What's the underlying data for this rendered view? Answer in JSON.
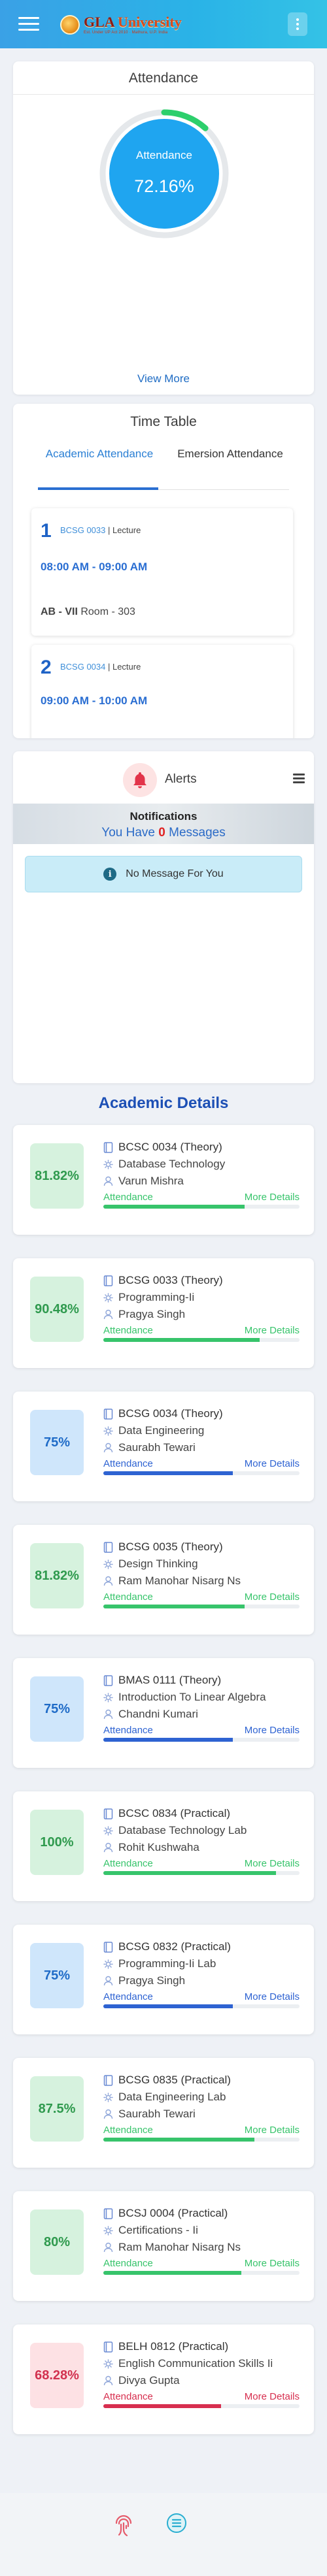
{
  "header": {
    "menu_icon": "hamburger-icon",
    "logo_name_g": "GLA",
    "logo_name_rest": " University",
    "logo_subtitle": "Est. Under UP Act 2010 · Mathura, U.P. India",
    "more_icon": "kebab-vertical-icon"
  },
  "attendance": {
    "title": "Attendance",
    "label": "Attendance",
    "percent": "72.16%",
    "percent_value": 72.16,
    "view_more": "View More",
    "colors": {
      "fill": "#1fa5f0",
      "progress": "#2dcf6c",
      "track": "#e5e8eb"
    }
  },
  "timetable": {
    "title": "Time Table",
    "tabs": [
      {
        "label": "Academic Attendance",
        "active": true
      },
      {
        "label": "Emersion Attendance",
        "active": false
      }
    ],
    "lectures": [
      {
        "num": "1",
        "code": "BCSG 0033",
        "type": " | Lecture",
        "time": "08:00 AM - 09:00 AM",
        "block": "AB - VII",
        "room": " Room - 303"
      },
      {
        "num": "2",
        "code": "BCSG 0034",
        "type": " | Lecture",
        "time": "09:00 AM - 10:00 AM",
        "block": "",
        "room": ""
      }
    ]
  },
  "alerts": {
    "title": "Alerts",
    "bell_icon": "bell-icon",
    "menu_icon": "list-menu-icon",
    "notifications_heading": "Notifications",
    "messages_prefix": "You Have ",
    "messages_count": "0",
    "messages_suffix": " Messages",
    "no_message": "No Message For You",
    "info_icon": "info-icon"
  },
  "academic": {
    "title": "Academic Details",
    "attendance_label": "Attendance",
    "more_details": "More Details",
    "colors": {
      "green": {
        "bg": "#d6f2de",
        "text": "#2f9a4e",
        "bar": "#37c46b"
      },
      "blue": {
        "bg": "#cfe6fb",
        "text": "#1f6bc7",
        "bar": "#2e63d2"
      },
      "red": {
        "bg": "#fde1e4",
        "text": "#d2314f",
        "bar": "#d72f4f"
      }
    },
    "courses": [
      {
        "percent": "81.82%",
        "value": 81.82,
        "tone": "green",
        "code": "BCSC 0034 (Theory)",
        "name": "Database Technology",
        "teacher": "Varun Mishra"
      },
      {
        "percent": "90.48%",
        "value": 90.48,
        "tone": "green",
        "code": "BCSG 0033 (Theory)",
        "name": "Programming-Ii",
        "teacher": "Pragya Singh"
      },
      {
        "percent": "75%",
        "value": 75,
        "tone": "blue",
        "code": "BCSG 0034 (Theory)",
        "name": "Data Engineering",
        "teacher": "Saurabh Tewari"
      },
      {
        "percent": "81.82%",
        "value": 81.82,
        "tone": "green",
        "code": "BCSG 0035 (Theory)",
        "name": "Design Thinking",
        "teacher": "Ram Manohar Nisarg Ns"
      },
      {
        "percent": "75%",
        "value": 75,
        "tone": "blue",
        "code": "BMAS 0111 (Theory)",
        "name": "Introduction To Linear Algebra",
        "teacher": "Chandni Kumari"
      },
      {
        "percent": "100%",
        "value": 100,
        "tone": "green",
        "code": "BCSC 0834 (Practical)",
        "name": "Database Technology Lab",
        "teacher": "Rohit Kushwaha"
      },
      {
        "percent": "75%",
        "value": 75,
        "tone": "blue",
        "code": "BCSG 0832 (Practical)",
        "name": "Programming-Ii Lab",
        "teacher": "Pragya Singh"
      },
      {
        "percent": "87.5%",
        "value": 87.5,
        "tone": "green",
        "code": "BCSG 0835 (Practical)",
        "name": "Data Engineering Lab",
        "teacher": "Saurabh Tewari"
      },
      {
        "percent": "80%",
        "value": 80,
        "tone": "green",
        "code": "BCSJ 0004 (Practical)",
        "name": "Certifications - Ii",
        "teacher": "Ram Manohar Nisarg Ns"
      },
      {
        "percent": "68.28%",
        "value": 68.28,
        "tone": "red",
        "code": "BELH 0812 (Practical)",
        "name": "English Communication Skills Ii",
        "teacher": "Divya Gupta"
      }
    ]
  },
  "bottom_nav": {
    "items": [
      {
        "icon": "fingerprint-icon"
      },
      {
        "icon": "menu-circle-icon"
      }
    ]
  }
}
